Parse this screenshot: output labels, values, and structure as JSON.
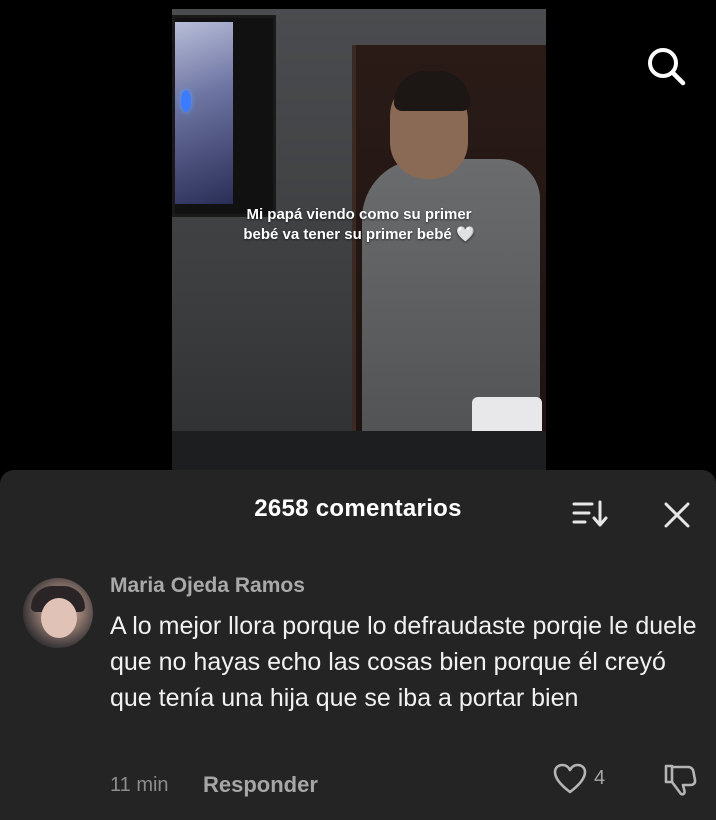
{
  "video": {
    "caption": "Mi papá viendo como su primer bebé va tener su primer bebé 🤍"
  },
  "icons": {
    "search": "search-icon",
    "sort": "sort-icon",
    "close": "close-icon",
    "like": "heart-icon",
    "dislike": "thumbs-down-icon"
  },
  "comments": {
    "title": "2658 comentarios",
    "items": [
      {
        "username": "Maria Ojeda Ramos",
        "text": "A lo mejor llora porque lo defraudaste porqie le duele que no hayas echo las cosas bien porque él creyó que tenía una hija que se iba a portar bien",
        "time": "11 min",
        "reply_label": "Responder",
        "likes": "4"
      }
    ]
  },
  "colors": {
    "sheet_bg": "#242424",
    "background": "#000000",
    "secondary_text": "#a6a6a6"
  }
}
